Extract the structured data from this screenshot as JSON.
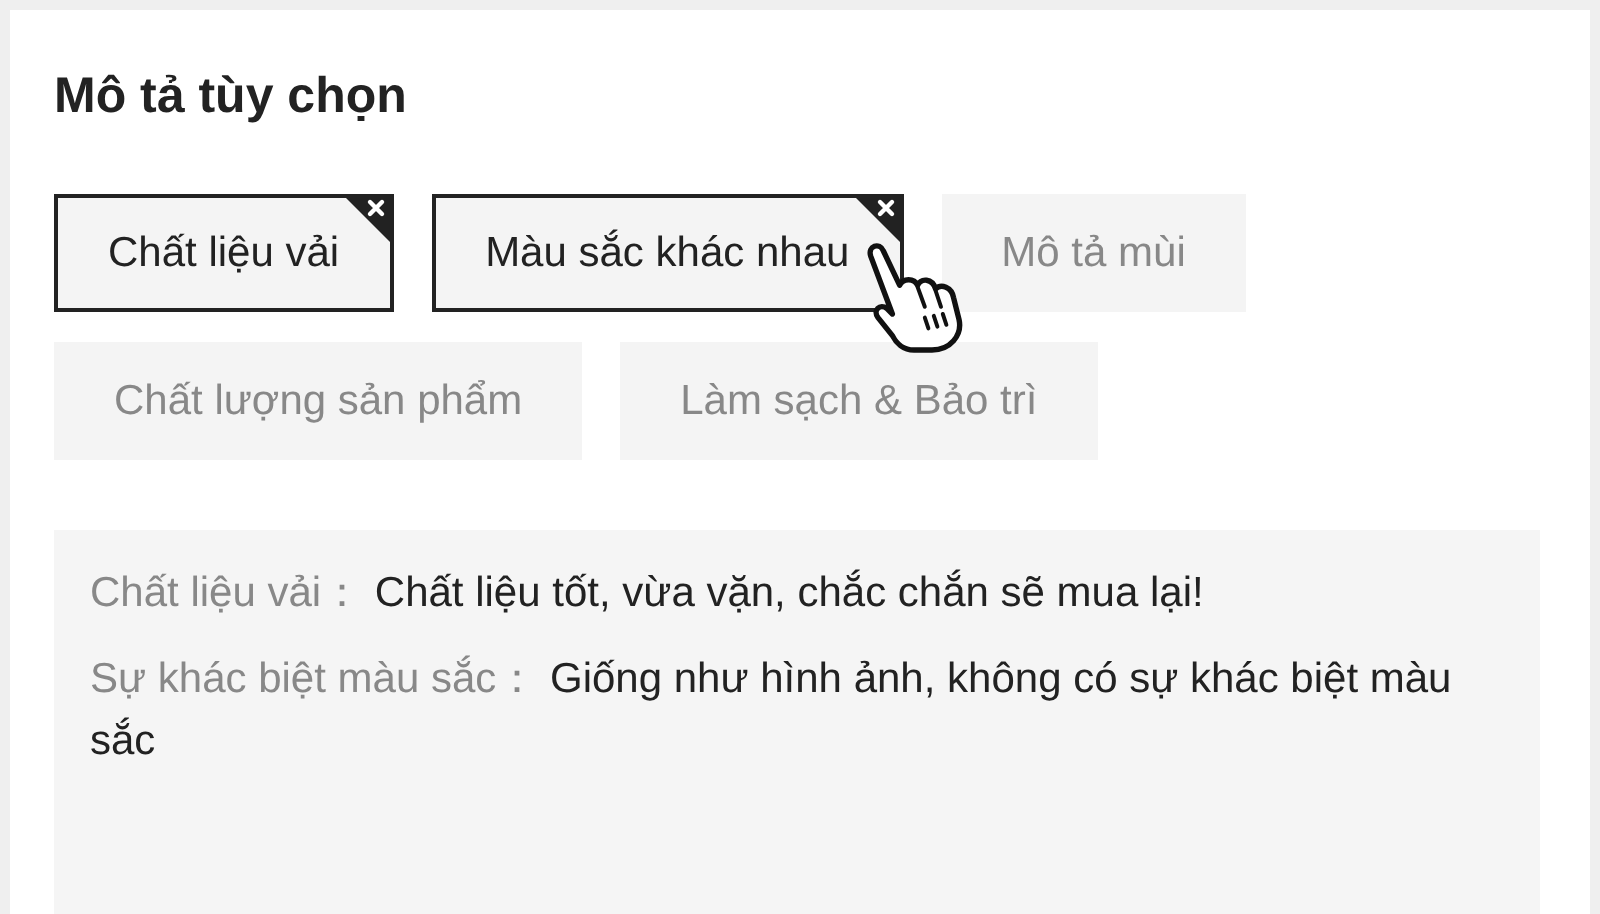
{
  "title": "Mô tả tùy chọn",
  "tags": [
    {
      "label": "Chất liệu vải",
      "selected": true
    },
    {
      "label": "Màu sắc khác nhau",
      "selected": true
    },
    {
      "label": "Mô tả mùi",
      "selected": false
    },
    {
      "label": "Chất lượng sản phẩm",
      "selected": false
    },
    {
      "label": "Làm sạch & Bảo trì",
      "selected": false
    }
  ],
  "descriptions": [
    {
      "label": "Chất liệu vải：",
      "text": "Chất liệu tốt, vừa vặn, chắc chắn sẽ mua lại!"
    },
    {
      "label": "Sự khác biệt màu sắc：",
      "text": "Giống như hình ảnh, không có sự khác biệt màu sắc"
    }
  ]
}
